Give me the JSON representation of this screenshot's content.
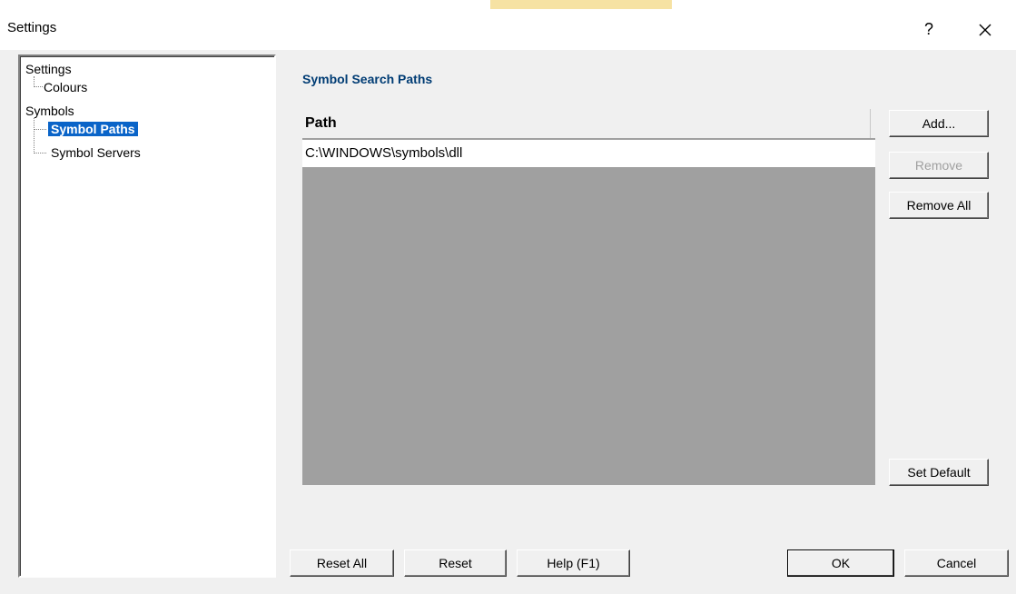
{
  "window": {
    "title": "Settings",
    "help_glyph": "?",
    "close_icon": "close-icon"
  },
  "tree": {
    "items": [
      {
        "label": "Settings",
        "level": 0
      },
      {
        "label": "Colours",
        "level": 1
      },
      {
        "label": "Symbols",
        "level": 0
      },
      {
        "label": "Symbol Paths",
        "level": 1,
        "selected": true
      },
      {
        "label": "Symbol Servers",
        "level": 1
      }
    ]
  },
  "panel": {
    "title": "Symbol Search Paths",
    "column_header": "Path",
    "rows": [
      "C:\\WINDOWS\\symbols\\dll"
    ]
  },
  "side_buttons": {
    "add": "Add...",
    "remove": "Remove",
    "remove_all": "Remove All",
    "set_default": "Set Default"
  },
  "footer_buttons": {
    "reset_all": "Reset All",
    "reset": "Reset",
    "help": "Help (F1)",
    "ok": "OK",
    "cancel": "Cancel"
  },
  "colors": {
    "selection": "#0a64c8",
    "section_title": "#003c74",
    "list_background": "#a0a0a0"
  }
}
